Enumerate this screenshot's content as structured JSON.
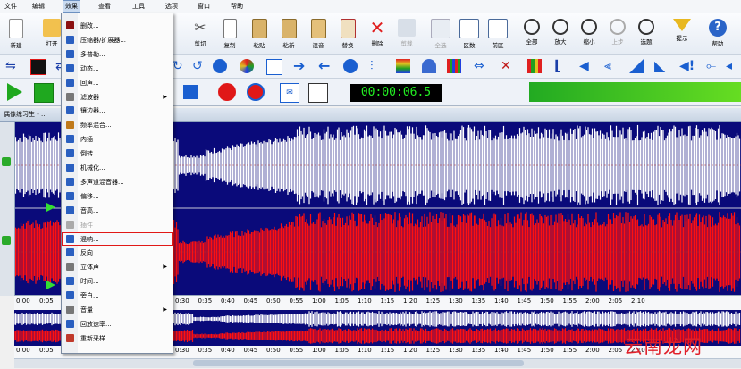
{
  "menubar": {
    "items": [
      "文件",
      "编辑",
      "效果",
      "查看",
      "工具",
      "选项",
      "窗口",
      "帮助"
    ],
    "active": "效果"
  },
  "toolbar1": {
    "buttons": [
      {
        "label": "新建",
        "icon": "new-file-icon"
      },
      {
        "label": "打开",
        "icon": "open-folder-icon"
      },
      {
        "label": "剪切",
        "icon": "scissors-icon"
      },
      {
        "label": "复制",
        "icon": "copy-icon"
      },
      {
        "label": "粘贴",
        "icon": "paste-icon"
      },
      {
        "label": "粘新",
        "icon": "paste-new-icon"
      },
      {
        "label": "混音",
        "icon": "mix-paste-icon"
      },
      {
        "label": "替换",
        "icon": "replace-icon"
      },
      {
        "label": "删除",
        "icon": "delete-icon"
      },
      {
        "label": "剪裁",
        "icon": "trim-icon"
      },
      {
        "label": "全选",
        "icon": "select-all-icon"
      },
      {
        "label": "区数",
        "icon": "region-icon"
      },
      {
        "label": "前区",
        "icon": "prev-region-icon"
      },
      {
        "label": "全部",
        "icon": "zoom-all-icon"
      },
      {
        "label": "放大",
        "icon": "zoom-in-icon"
      },
      {
        "label": "缩小",
        "icon": "zoom-out-icon"
      },
      {
        "label": "上步",
        "icon": "undo-zoom-icon"
      },
      {
        "label": "选题",
        "icon": "zoom-selection-icon"
      },
      {
        "label": "提示",
        "icon": "marker-icon"
      },
      {
        "label": "帮助",
        "icon": "help-icon"
      }
    ]
  },
  "transport": {
    "time": "00:00:06.5"
  },
  "track": {
    "title": "偶像练习生 - ..."
  },
  "ruler": {
    "ticks": [
      "0:00",
      "0:05",
      "0:30",
      "0:35",
      "0:40",
      "0:45",
      "0:50",
      "0:55",
      "1:00",
      "1:05",
      "1:10",
      "1:15",
      "1:20",
      "1:25",
      "1:30",
      "1:35",
      "1:40",
      "1:45",
      "1:50",
      "1:55",
      "2:00",
      "2:05",
      "2:10"
    ]
  },
  "effects_menu": {
    "items": [
      {
        "label": "删改...",
        "icon": "amplify-icon",
        "color": "#8b1010"
      },
      {
        "label": "压缩器/扩展器...",
        "icon": "compressor-icon",
        "color": "#2a5fc0"
      },
      {
        "label": "多普勒...",
        "icon": "doppler-icon",
        "color": "#2a5fc0"
      },
      {
        "label": "动态...",
        "icon": "dynamics-icon",
        "color": "#2a5fc0"
      },
      {
        "label": "回声...",
        "icon": "echo-icon",
        "color": "#2a5fc0"
      },
      {
        "label": "滤波器",
        "icon": "filter-icon",
        "color": "#777777",
        "submenu": true
      },
      {
        "label": "镶边器...",
        "icon": "flanger-icon",
        "color": "#2a5fc0"
      },
      {
        "label": "频率混合...",
        "icon": "frequency-mix-icon",
        "color": "#c07a1a"
      },
      {
        "label": "内插",
        "icon": "interpolate-icon",
        "color": "#2a5fc0"
      },
      {
        "label": "倒转",
        "icon": "invert-icon",
        "color": "#2a5fc0"
      },
      {
        "label": "机械化...",
        "icon": "mechanize-icon",
        "color": "#2a5fc0"
      },
      {
        "label": "多声道混音器...",
        "icon": "multichannel-mixer-icon",
        "color": "#2a5fc0"
      },
      {
        "label": "偏移...",
        "icon": "offset-icon",
        "color": "#2a5fc0"
      },
      {
        "label": "音高...",
        "icon": "pitch-icon",
        "color": "#2a5fc0"
      },
      {
        "label": "插件",
        "icon": "plugin-icon",
        "color": "#aaaaaa",
        "disabled": true
      },
      {
        "label": "混响...",
        "icon": "reverb-icon",
        "color": "#2a5fc0",
        "highlighted": true
      },
      {
        "label": "反向",
        "icon": "reverse-icon",
        "color": "#2a5fc0"
      },
      {
        "label": "立体声",
        "icon": "stereo-icon",
        "color": "#777777",
        "submenu": true
      },
      {
        "label": "时间...",
        "icon": "time-icon",
        "color": "#2a5fc0"
      },
      {
        "label": "旁白...",
        "icon": "narration-icon",
        "color": "#2a5fc0"
      },
      {
        "label": "音量",
        "icon": "volume-icon",
        "color": "#777777",
        "submenu": true
      },
      {
        "label": "回放速率...",
        "icon": "playback-rate-icon",
        "color": "#2a5fc0"
      },
      {
        "label": "重新采样...",
        "icon": "resample-icon",
        "color": "#c0392b"
      }
    ]
  },
  "colors": {
    "wave_bg": "#0a0a7a",
    "left_channel": "#ffffff",
    "right_channel": "#ff1010",
    "highlight_border": "#e01818",
    "timecode": "#22ee22"
  },
  "watermark": "云南龙网"
}
